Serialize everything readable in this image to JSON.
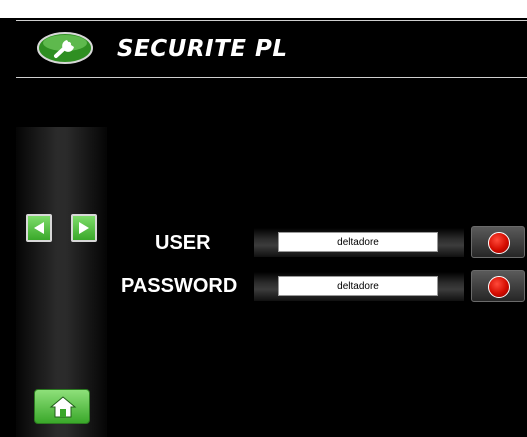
{
  "header": {
    "title": "SECURITE PL",
    "logo_icon": "wrench-icon"
  },
  "sidebar": {
    "prev_icon": "arrow-left-icon",
    "next_icon": "arrow-right-icon",
    "home_icon": "home-icon"
  },
  "login": {
    "user_label": "USER",
    "user_value": "deltadore",
    "password_label": "PASSWORD",
    "password_value": "deltadore"
  },
  "colors": {
    "background": "#000000",
    "accent_green": "#4cbb3a",
    "confirm_red": "#d40c00"
  }
}
